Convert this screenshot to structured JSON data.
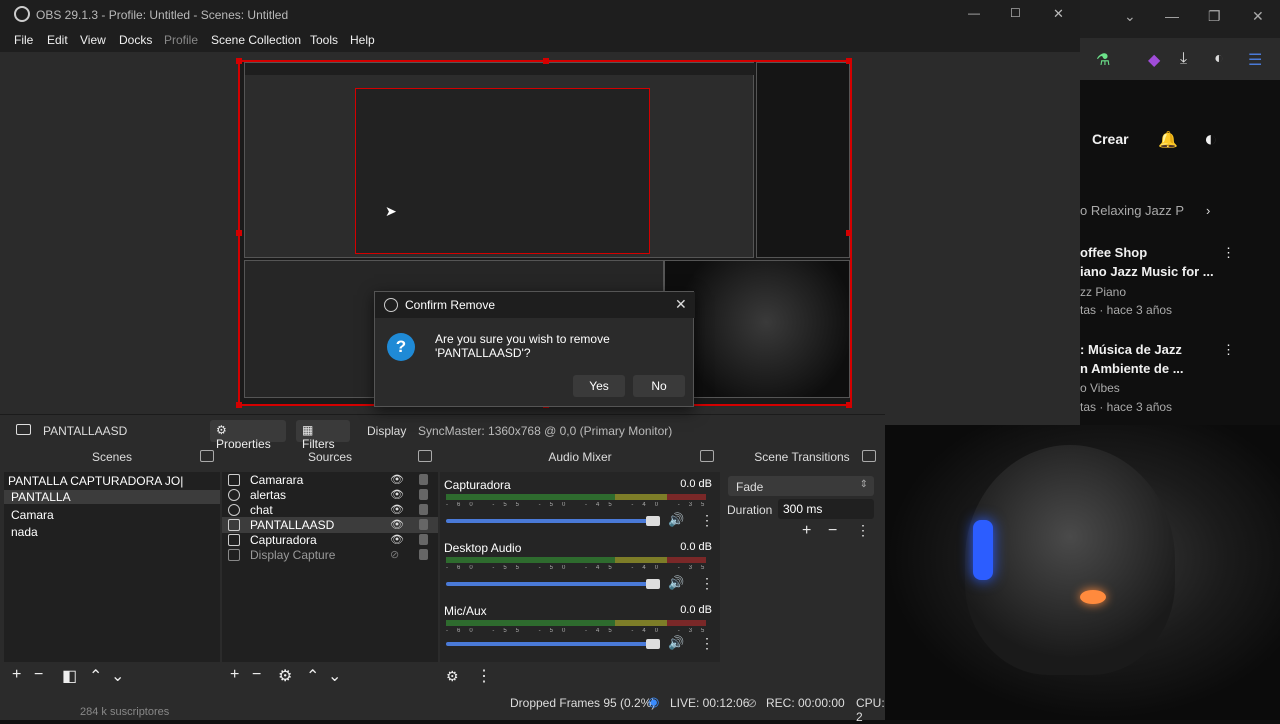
{
  "window": {
    "title": "OBS 29.1.3 - Profile: Untitled - Scenes: Untitled",
    "controls": [
      "—",
      "☐",
      "✕"
    ]
  },
  "menu": [
    "File",
    "Edit",
    "View",
    "Docks",
    "Profile",
    "Scene Collection",
    "Tools",
    "Help"
  ],
  "source_toolbar": {
    "selected_source": "PANTALLAASD",
    "properties": "Properties",
    "filters": "Filters",
    "display_label": "Display",
    "display_value": "SyncMaster: 1360x768 @ 0,0 (Primary Monitor)"
  },
  "scenes": {
    "title": "Scenes",
    "items": [
      "PANTALLA CAPTURADORA JO|",
      "PANTALLA",
      "Camara",
      "nada"
    ],
    "selected": 1
  },
  "sources": {
    "title": "Sources",
    "items": [
      "Camarara",
      "alertas",
      "chat",
      "PANTALLAASD",
      "Capturadora",
      "Display Capture"
    ]
  },
  "mixer": {
    "title": "Audio Mixer",
    "channels": [
      {
        "name": "Capturadora",
        "db": "0.0 dB"
      },
      {
        "name": "Desktop Audio",
        "db": "0.0 dB"
      },
      {
        "name": "Mic/Aux",
        "db": "0.0 dB"
      }
    ],
    "ticks": "-60 -55 -50 -45 -40 -35 -30 -25 -20 -15 -10 -5 0"
  },
  "transitions": {
    "title": "Scene Transitions",
    "type": "Fade",
    "duration_label": "Duration",
    "duration": "300 ms"
  },
  "dialog": {
    "title": "Confirm Remove",
    "message": "Are you sure you wish to remove 'PANTALLAASD'?",
    "yes": "Yes",
    "no": "No"
  },
  "status": {
    "dropped": "Dropped Frames 95 (0.2%)",
    "live": "LIVE: 00:12:06",
    "rec": "REC: 00:00:00",
    "cpu": "CPU: 2"
  },
  "browser": {
    "create": "Crear",
    "chip": "o Relaxing Jazz P",
    "videos": [
      {
        "title1": "offee Shop",
        "title2": "iano Jazz Music for ...",
        "channel": "zz Piano",
        "meta": "tas · hace 3 años"
      },
      {
        "title1": ": Música de Jazz",
        "title2": "n Ambiente de ...",
        "channel": "o Vibes",
        "meta": "tas · hace 3 años"
      }
    ],
    "subscribers": "284 k suscriptores"
  }
}
